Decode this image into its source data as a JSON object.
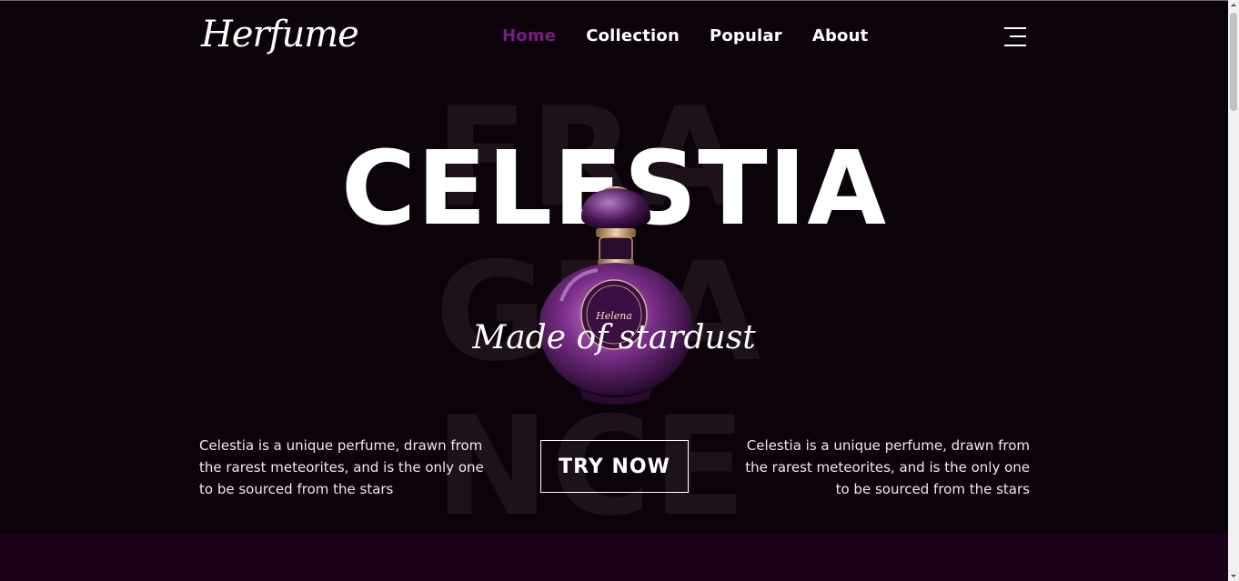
{
  "header": {
    "logo": "Herfume",
    "nav": [
      {
        "label": "Home",
        "active": true
      },
      {
        "label": "Collection",
        "active": false
      },
      {
        "label": "Popular",
        "active": false
      },
      {
        "label": "About",
        "active": false
      }
    ],
    "menu_icon": "hamburger-menu-icon"
  },
  "hero": {
    "watermark_lines": [
      "FRA",
      "GRA",
      "NCE"
    ],
    "title": "CELESTIA",
    "tagline": "Made of stardust",
    "description_left": "Celestia is a unique perfume, drawn from the rarest meteorites, and is the only one to be sourced from the stars",
    "description_right": "Celestia is a unique perfume, drawn from the rarest meteorites, and is the only one to be sourced from the stars",
    "cta_label": "TRY NOW",
    "bottle_label": "Helena"
  },
  "colors": {
    "background": "#0c0209",
    "accent": "#7a1a86",
    "next_section": "#1b0219"
  }
}
